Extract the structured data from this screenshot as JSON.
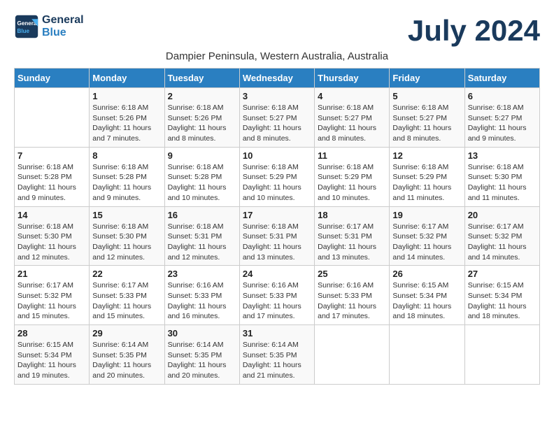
{
  "header": {
    "logo_line1": "General",
    "logo_line2": "Blue",
    "month_title": "July 2024",
    "subtitle": "Dampier Peninsula, Western Australia, Australia"
  },
  "days_of_week": [
    "Sunday",
    "Monday",
    "Tuesday",
    "Wednesday",
    "Thursday",
    "Friday",
    "Saturday"
  ],
  "weeks": [
    [
      {
        "day": "",
        "info": ""
      },
      {
        "day": "1",
        "info": "Sunrise: 6:18 AM\nSunset: 5:26 PM\nDaylight: 11 hours\nand 7 minutes."
      },
      {
        "day": "2",
        "info": "Sunrise: 6:18 AM\nSunset: 5:26 PM\nDaylight: 11 hours\nand 8 minutes."
      },
      {
        "day": "3",
        "info": "Sunrise: 6:18 AM\nSunset: 5:27 PM\nDaylight: 11 hours\nand 8 minutes."
      },
      {
        "day": "4",
        "info": "Sunrise: 6:18 AM\nSunset: 5:27 PM\nDaylight: 11 hours\nand 8 minutes."
      },
      {
        "day": "5",
        "info": "Sunrise: 6:18 AM\nSunset: 5:27 PM\nDaylight: 11 hours\nand 8 minutes."
      },
      {
        "day": "6",
        "info": "Sunrise: 6:18 AM\nSunset: 5:27 PM\nDaylight: 11 hours\nand 9 minutes."
      }
    ],
    [
      {
        "day": "7",
        "info": "Sunrise: 6:18 AM\nSunset: 5:28 PM\nDaylight: 11 hours\nand 9 minutes."
      },
      {
        "day": "8",
        "info": "Sunrise: 6:18 AM\nSunset: 5:28 PM\nDaylight: 11 hours\nand 9 minutes."
      },
      {
        "day": "9",
        "info": "Sunrise: 6:18 AM\nSunset: 5:28 PM\nDaylight: 11 hours\nand 10 minutes."
      },
      {
        "day": "10",
        "info": "Sunrise: 6:18 AM\nSunset: 5:29 PM\nDaylight: 11 hours\nand 10 minutes."
      },
      {
        "day": "11",
        "info": "Sunrise: 6:18 AM\nSunset: 5:29 PM\nDaylight: 11 hours\nand 10 minutes."
      },
      {
        "day": "12",
        "info": "Sunrise: 6:18 AM\nSunset: 5:29 PM\nDaylight: 11 hours\nand 11 minutes."
      },
      {
        "day": "13",
        "info": "Sunrise: 6:18 AM\nSunset: 5:30 PM\nDaylight: 11 hours\nand 11 minutes."
      }
    ],
    [
      {
        "day": "14",
        "info": "Sunrise: 6:18 AM\nSunset: 5:30 PM\nDaylight: 11 hours\nand 12 minutes."
      },
      {
        "day": "15",
        "info": "Sunrise: 6:18 AM\nSunset: 5:30 PM\nDaylight: 11 hours\nand 12 minutes."
      },
      {
        "day": "16",
        "info": "Sunrise: 6:18 AM\nSunset: 5:31 PM\nDaylight: 11 hours\nand 12 minutes."
      },
      {
        "day": "17",
        "info": "Sunrise: 6:18 AM\nSunset: 5:31 PM\nDaylight: 11 hours\nand 13 minutes."
      },
      {
        "day": "18",
        "info": "Sunrise: 6:17 AM\nSunset: 5:31 PM\nDaylight: 11 hours\nand 13 minutes."
      },
      {
        "day": "19",
        "info": "Sunrise: 6:17 AM\nSunset: 5:32 PM\nDaylight: 11 hours\nand 14 minutes."
      },
      {
        "day": "20",
        "info": "Sunrise: 6:17 AM\nSunset: 5:32 PM\nDaylight: 11 hours\nand 14 minutes."
      }
    ],
    [
      {
        "day": "21",
        "info": "Sunrise: 6:17 AM\nSunset: 5:32 PM\nDaylight: 11 hours\nand 15 minutes."
      },
      {
        "day": "22",
        "info": "Sunrise: 6:17 AM\nSunset: 5:33 PM\nDaylight: 11 hours\nand 15 minutes."
      },
      {
        "day": "23",
        "info": "Sunrise: 6:16 AM\nSunset: 5:33 PM\nDaylight: 11 hours\nand 16 minutes."
      },
      {
        "day": "24",
        "info": "Sunrise: 6:16 AM\nSunset: 5:33 PM\nDaylight: 11 hours\nand 17 minutes."
      },
      {
        "day": "25",
        "info": "Sunrise: 6:16 AM\nSunset: 5:33 PM\nDaylight: 11 hours\nand 17 minutes."
      },
      {
        "day": "26",
        "info": "Sunrise: 6:15 AM\nSunset: 5:34 PM\nDaylight: 11 hours\nand 18 minutes."
      },
      {
        "day": "27",
        "info": "Sunrise: 6:15 AM\nSunset: 5:34 PM\nDaylight: 11 hours\nand 18 minutes."
      }
    ],
    [
      {
        "day": "28",
        "info": "Sunrise: 6:15 AM\nSunset: 5:34 PM\nDaylight: 11 hours\nand 19 minutes."
      },
      {
        "day": "29",
        "info": "Sunrise: 6:14 AM\nSunset: 5:35 PM\nDaylight: 11 hours\nand 20 minutes."
      },
      {
        "day": "30",
        "info": "Sunrise: 6:14 AM\nSunset: 5:35 PM\nDaylight: 11 hours\nand 20 minutes."
      },
      {
        "day": "31",
        "info": "Sunrise: 6:14 AM\nSunset: 5:35 PM\nDaylight: 11 hours\nand 21 minutes."
      },
      {
        "day": "",
        "info": ""
      },
      {
        "day": "",
        "info": ""
      },
      {
        "day": "",
        "info": ""
      }
    ]
  ]
}
